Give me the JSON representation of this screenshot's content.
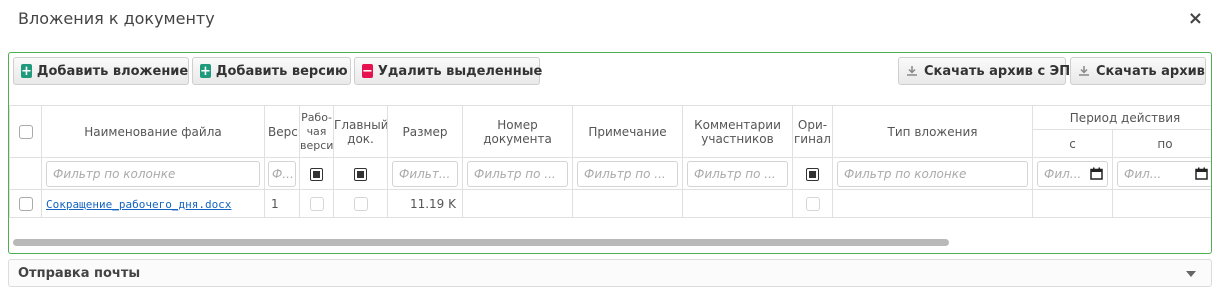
{
  "dialog": {
    "title": "Вложения к документу",
    "close": "×"
  },
  "toolbar": {
    "add_attachment": "Добавить вложение",
    "add_version": "Добавить версию",
    "delete_selected": "Удалить выделенные",
    "download_archive_ep": "Скачать архив с ЭП",
    "download_archive": "Скачать архив"
  },
  "columns": {
    "file_name": "Наименование файла",
    "version": "Версия",
    "working_version": "Рабо-\nчая\nверсия",
    "main_doc": "Главный\nдок.",
    "size": "Размер",
    "doc_number": "Номер\nдокумента",
    "note": "Примечание",
    "participants_comments": "Комментарии\nучастников",
    "original": "Ори-\nгинал",
    "attachment_type": "Тип вложения",
    "validity_period": "Период действия",
    "from": "с",
    "to": "по"
  },
  "filters": {
    "file_name": "Фильтр по колонке",
    "version": "Ф...",
    "size": "Фильт...",
    "doc_number": "Фильтр по ...",
    "note": "Фильтр по ...",
    "participants_comments": "Фильтр по ...",
    "attachment_type": "Фильтр по колонке",
    "from": "Фил...",
    "to": "Фил..."
  },
  "rows": [
    {
      "file_name": "Сокращение_рабочего_дня.docx",
      "version": "1",
      "size": "11.19 K"
    }
  ],
  "mail_section": {
    "title": "Отправка почты"
  },
  "colors": {
    "panel_border": "#4caf50",
    "add_icon": "#1f9a7c",
    "delete_icon": "#e6124f",
    "link": "#1565c0"
  }
}
